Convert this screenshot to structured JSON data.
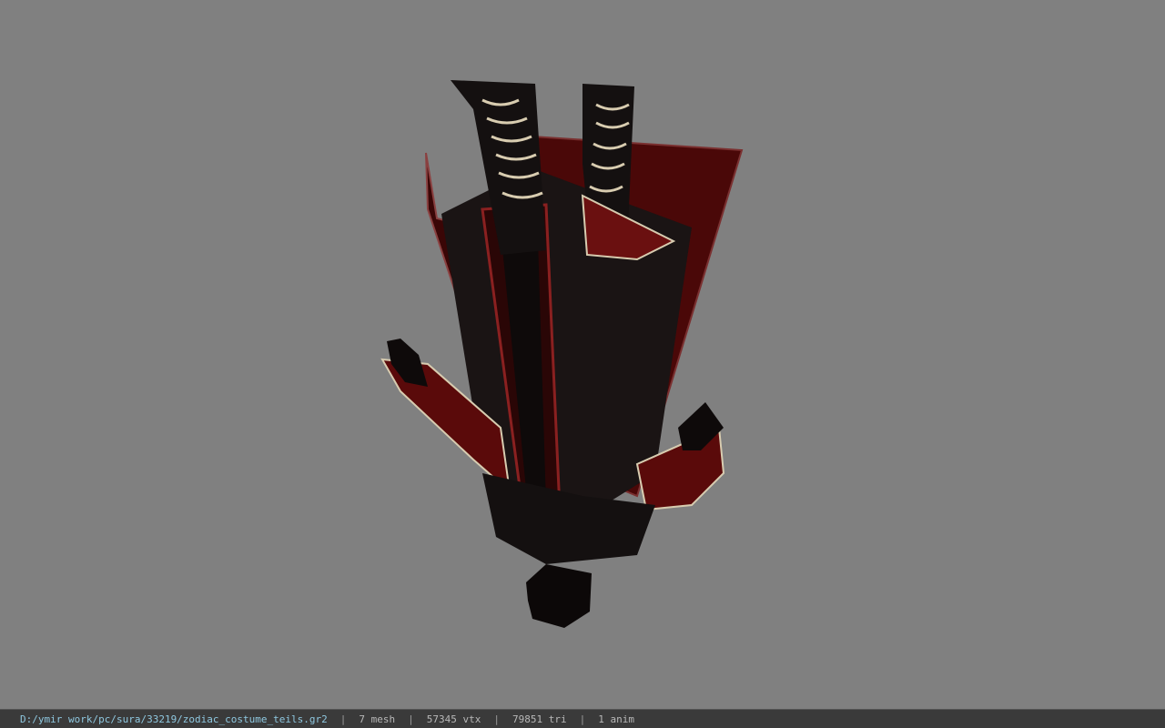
{
  "viewport": {
    "background": "#808080",
    "model": {
      "description_icon": "character-model-upside-down",
      "colors": {
        "cloth_dark": "#1a1414",
        "cloth_red": "#5a0a0a",
        "trim_bone": "#d8ccb0",
        "skin": "#c8a898"
      }
    }
  },
  "status_bar": {
    "path": "D:/ymir work/pc/sura/33219/zodiac_costume_teils.gr2",
    "separator": "|",
    "mesh": "7 mesh",
    "vtx": "57345 vtx",
    "tri": "79851 tri",
    "anim": "1 anim"
  }
}
